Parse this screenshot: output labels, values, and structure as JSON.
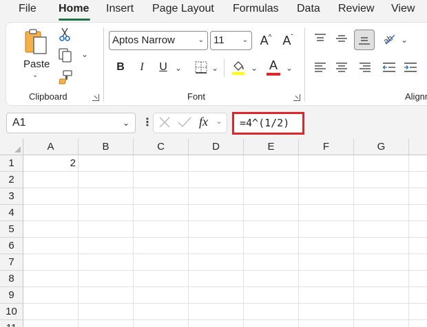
{
  "tabs": [
    "File",
    "Home",
    "Insert",
    "Page Layout",
    "Formulas",
    "Data",
    "Review",
    "View"
  ],
  "active_tab": "Home",
  "clipboard": {
    "paste_label": "Paste",
    "group_label": "Clipboard"
  },
  "font": {
    "name": "Aptos Narrow",
    "size": "11",
    "bold_label": "B",
    "italic_label": "I",
    "underline_label": "U",
    "grow_label": "A",
    "shrink_label": "A",
    "font_color_label": "A",
    "group_label": "Font",
    "highlight_color": "#ffff00",
    "font_color": "#e0242a"
  },
  "alignment": {
    "group_label": "Alignm"
  },
  "formula_bar": {
    "name_box": "A1",
    "fx_label": "fx",
    "formula": "=4^(1/2)"
  },
  "columns": [
    "A",
    "B",
    "C",
    "D",
    "E",
    "F",
    "G"
  ],
  "rows": [
    "1",
    "2",
    "3",
    "4",
    "5",
    "6",
    "7",
    "8",
    "9",
    "10",
    "11"
  ],
  "cells": {
    "A1": "2"
  },
  "colors": {
    "accent": "#217346",
    "highlight_box": "#e0242a"
  }
}
